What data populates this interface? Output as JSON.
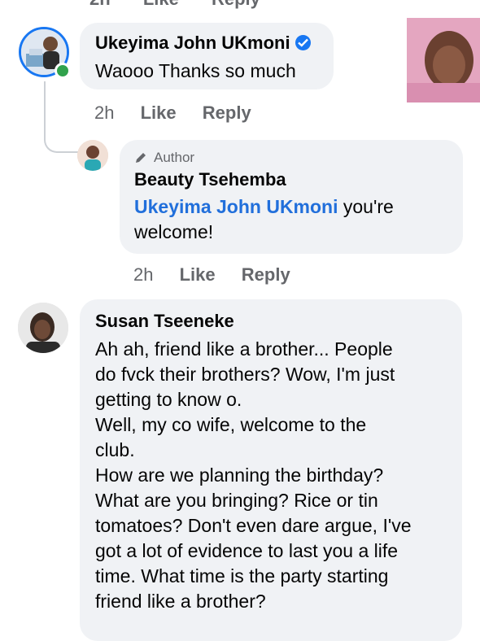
{
  "top_actions": {
    "time": "2h",
    "like": "Like",
    "reply": "Reply"
  },
  "comment1": {
    "author": "Ukeyima John UKmoni",
    "text": "Waooo Thanks so much",
    "time": "2h",
    "like": "Like",
    "reply": "Reply"
  },
  "reply1": {
    "badge": "Author",
    "author": "Beauty Tsehemba",
    "mention": "Ukeyima John UKmoni",
    "text_line1_rest": " you're",
    "text_line2": "welcome!",
    "time": "2h",
    "like": "Like",
    "reply": "Reply"
  },
  "comment2": {
    "author": "Susan Tseeneke",
    "lines": [
      "Ah ah, friend like a brother... People",
      "do fvck their brothers? Wow, I'm just",
      "getting to know o.",
      "Well, my co wife, welcome to the",
      "club.",
      "How are we planning the birthday?",
      "What are you bringing? Rice or tin",
      "tomatoes? Don't even dare argue, I've",
      "got a lot of evidence to last you a life",
      "time. What time is the party starting",
      "friend like a brother?"
    ]
  },
  "colors": {
    "accent": "#1877f2",
    "online": "#31a24c",
    "bubble": "#f0f2f5",
    "secondary_text": "#65676b"
  }
}
